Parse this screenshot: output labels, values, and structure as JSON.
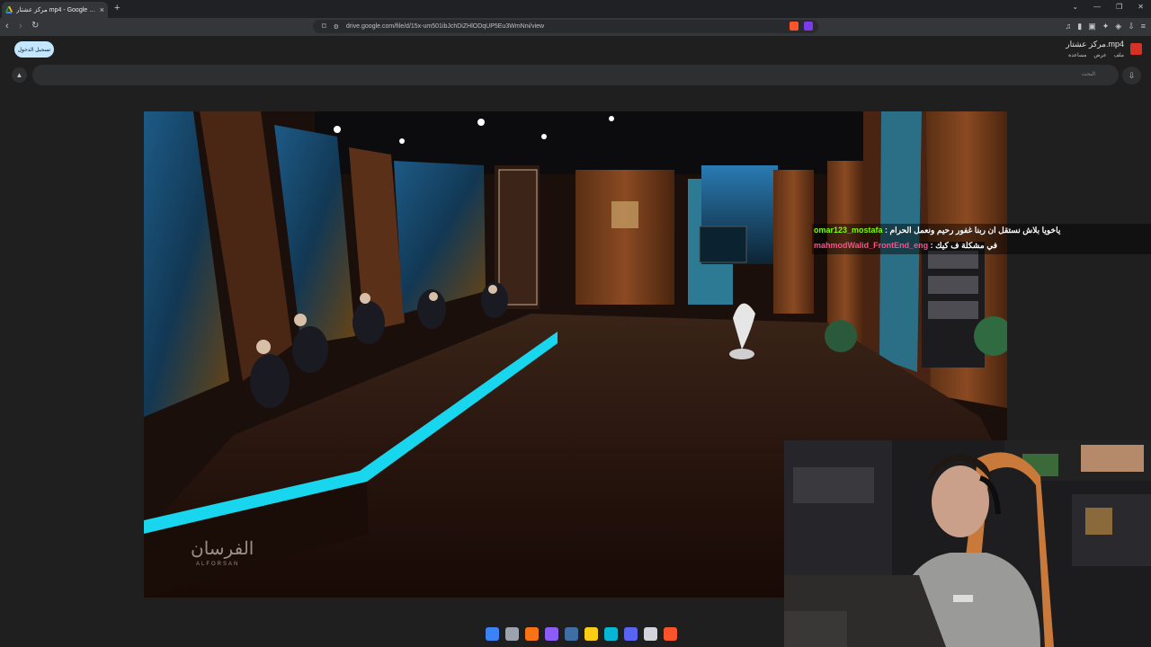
{
  "browser": {
    "tab_title": "مركز عشتار mp4 - Google Drive",
    "new_tab": "+",
    "url": "drive.google.com/file/d/15x-um501ibJchDiZHlODqUP5Eu3WmNni/view"
  },
  "drive": {
    "file_title": "مركز عشتار.mp4",
    "menu": [
      "ملف",
      "عرض",
      "مساعدة"
    ],
    "signin_label": "تسجيل الدخول",
    "search_placeholder": "البحث"
  },
  "video": {
    "watermark": "الفرسان",
    "watermark_sub": "ALFORSAN"
  },
  "chat": {
    "messages": [
      {
        "user": "omar123_mostafa",
        "sep": " : ",
        "text": "ياخويا بلاش نستقل ان ربنا غفور رحيم ونعمل الحرام"
      },
      {
        "user": "mahmodWalid_FrontEnd_eng",
        "sep": " : ",
        "text": "في مشكلة ف كيك"
      }
    ]
  },
  "colors": {
    "signin_bg": "#c2e7ff",
    "chat_user_1": "#7cfc00",
    "chat_user_2": "#ff4d8d",
    "floor_neon": "#18d6ee",
    "drive_bg": "#1f1f1f"
  },
  "icons": {
    "taskbar": [
      "windows-start-icon",
      "task-view-icon",
      "app-icon",
      "app-icon",
      "steam-icon",
      "file-explorer-icon",
      "app-icon",
      "discord-icon",
      "app-icon",
      "brave-icon"
    ]
  }
}
